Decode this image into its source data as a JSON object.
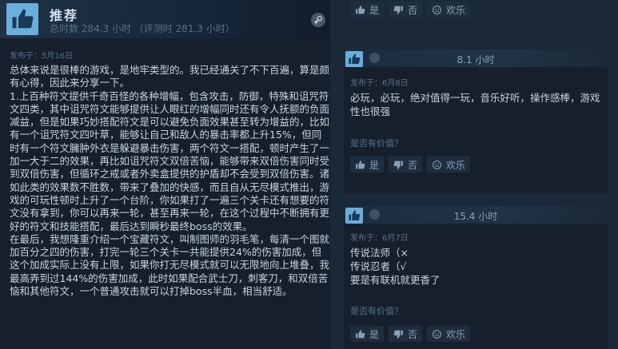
{
  "main_review": {
    "title": "推荐",
    "hours": "总时数 284.3 小时 （评测时 281.3 小时）",
    "posted": "发布于：5月16日",
    "body": "总体来说是很棒的游戏，是地牢类型的。我已经通关了不下百遍，算是颇有心得，因此来分享一下。\n1.上百种符文提供千奇百怪的各种增幅，包含攻击，防御，特殊和诅咒符文四类，其中诅咒符文能够提供让人眼红的增幅同时还有令人抚额的负面减益，但是如果巧妙搭配符文是可以避免负面效果甚至转为增益的，比如有一个诅咒符文四叶草，能够让自己和敌人的暴击率都上升15%，但同时有一个符文臃肿外衣是躲避暴击伤害，两个符文一搭配，顿时产生了一加一大于二的效果，再比如诅咒符文双倍苦恼，能够带来双倍伤害同时受到双倍伤害，但循环之戒或者外卖盒提供的护盾却不会受到双倍伤害。诸如此类的效果数不胜数，带来了叠加的快感，而且自从无尽模式推出，游戏的可玩性顿时上升了一个台阶，你如果打了一遍三个关卡还有想要的符文没有拿到，你可以再来一轮，甚至再来一轮，在这个过程中不断拥有更好的符文和技能搭配，最后达到瞬秒最终boss的效果。\n在最后，我想隆重介绍一个宝藏符文，叫制图师的羽毛笔，每清一个图就加百分之四的伤害，打完一轮三个关卡一共能提供24%的伤害加成，但这个加成实际上没有上限，如果你打无尽模式就可以无限地向上堆叠，我最高弄到过144%的伤害加成，此时如果配合武士刀，刺客刀，和双倍苦恼和其他符文，一个普通攻击就可以打掉boss半血，相当舒适。"
  },
  "votes": {
    "yes": "是",
    "no": "否",
    "funny": "欢乐"
  },
  "helpful_question": "是否有价值？",
  "side_reviews": [
    {
      "hours": "8.1 小时",
      "posted": "发布于：6月8日",
      "body": "必玩，必玩，绝对值得一玩，音乐好听，操作感棒，游戏性也很强"
    },
    {
      "hours": "15.4 小时",
      "posted": "发布于：6月7日",
      "body": "传说法师（×\n传说忍者（√\n要是有联机就更香了"
    }
  ]
}
